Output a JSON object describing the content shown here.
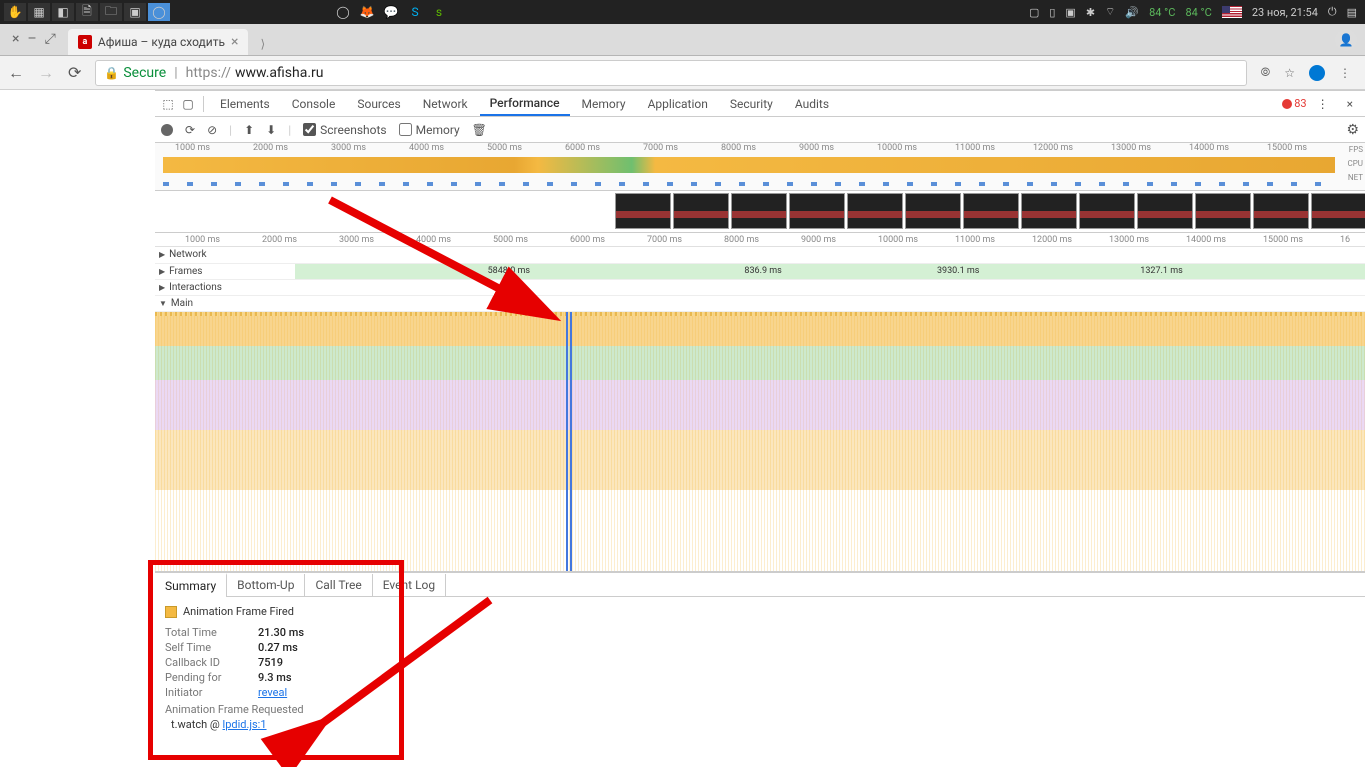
{
  "os": {
    "temp1": "84 °C",
    "temp2": "84 °C",
    "datetime": "23 ноя, 21:54"
  },
  "tab": {
    "title": "Афиша – куда сходить",
    "favicon": "a"
  },
  "addr": {
    "secure": "Secure",
    "proto": "https://",
    "host": "www.afisha.ru"
  },
  "dt": {
    "tabs": [
      "Elements",
      "Console",
      "Sources",
      "Network",
      "Performance",
      "Memory",
      "Application",
      "Security",
      "Audits"
    ],
    "activeTab": "Performance",
    "errors": "83",
    "toolbar": {
      "screenshots": "Screenshots",
      "memory": "Memory"
    },
    "ovTicks": [
      "1000 ms",
      "2000 ms",
      "3000 ms",
      "4000 ms",
      "5000 ms",
      "6000 ms",
      "7000 ms",
      "8000 ms",
      "9000 ms",
      "10000 ms",
      "11000 ms",
      "12000 ms",
      "13000 ms",
      "14000 ms",
      "15000 ms"
    ],
    "tlTicks": [
      "1000 ms",
      "2000 ms",
      "3000 ms",
      "4000 ms",
      "5000 ms",
      "6000 ms",
      "7000 ms",
      "8000 ms",
      "9000 ms",
      "10000 ms",
      "11000 ms",
      "12000 ms",
      "13000 ms",
      "14000 ms",
      "15000 ms",
      "16"
    ],
    "ovLabels": {
      "fps": "FPS",
      "cpu": "CPU",
      "net": "NET"
    },
    "tracks": {
      "network": "Network",
      "frames": "Frames",
      "interactions": "Interactions",
      "main": "Main"
    },
    "frames": {
      "f1": "5848.0 ms",
      "f2": "836.9 ms",
      "f3": "3930.1 ms",
      "f4": "1327.1 ms"
    }
  },
  "summary": {
    "tabs": {
      "summary": "Summary",
      "bottomup": "Bottom-Up",
      "calltree": "Call Tree",
      "eventlog": "Event Log"
    },
    "event": "Animation Frame Fired",
    "totalTimeK": "Total Time",
    "totalTimeV": "21.30 ms",
    "selfTimeK": "Self Time",
    "selfTimeV": "0.27 ms",
    "callbackK": "Callback ID",
    "callbackV": "7519",
    "pendingK": "Pending for",
    "pendingV": "9.3 ms",
    "initiatorK": "Initiator",
    "initiatorV": "reveal",
    "afr": "Animation Frame Requested",
    "stackFn": "t.watch",
    "stackAt": "@",
    "stackSrc": "lpdid.js:1"
  }
}
